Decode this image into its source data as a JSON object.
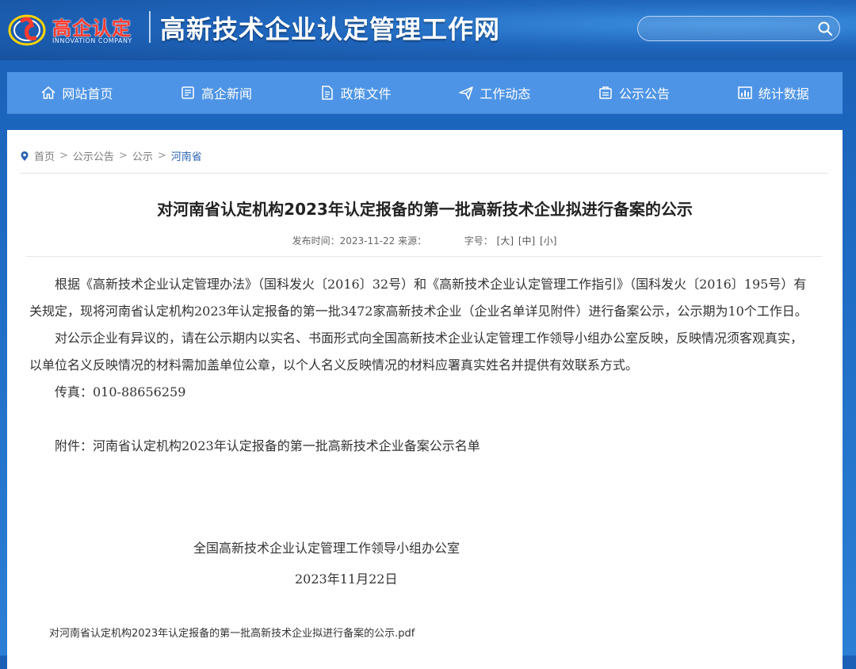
{
  "header": {
    "logo_cn": "高企认定",
    "logo_en": "INNOVATION COMPANY",
    "site_title": "高新技术企业认定管理工作网",
    "search_placeholder": ""
  },
  "nav": [
    {
      "label": "网站首页",
      "icon": "home-icon"
    },
    {
      "label": "高企新闻",
      "icon": "news-icon"
    },
    {
      "label": "政策文件",
      "icon": "document-icon"
    },
    {
      "label": "工作动态",
      "icon": "send-icon"
    },
    {
      "label": "公示公告",
      "icon": "notice-icon"
    },
    {
      "label": "统计数据",
      "icon": "chart-icon"
    }
  ],
  "breadcrumb": [
    "首页",
    "公示公告",
    "公示",
    "河南省"
  ],
  "article": {
    "title": "对河南省认定机构2023年认定报备的第一批高新技术企业拟进行备案的公示",
    "publish_label": "发布时间：2023-11-22 来源：",
    "font_size_label": "字号：",
    "font_sizes": [
      "[大]",
      "[中]",
      "[小]"
    ],
    "paragraphs": [
      "根据《高新技术企业认定管理办法》（国科发火〔2016〕32号）和《高新技术企业认定管理工作指引》（国科发火〔2016〕195号）有关规定，现将河南省认定机构2023年认定报备的第一批3472家高新技术企业（企业名单详见附件）进行备案公示，公示期为10个工作日。",
      "对公示企业有异议的，请在公示期内以实名、书面形式向全国高新技术企业认定管理工作领导小组办公室反映，反映情况须客观真实，以单位名义反映情况的材料需加盖单位公章，以个人名义反映情况的材料应署真实姓名并提供有效联系方式。",
      "传真：010-88656259",
      "附件：河南省认定机构2023年认定报备的第一批高新技术企业备案公示名单"
    ],
    "signature": "全国高新技术企业认定管理工作领导小组办公室",
    "date": "2023年11月22日",
    "attachment_file": "对河南省认定机构2023年认定报备的第一批高新技术企业拟进行备案的公示.pdf"
  },
  "colors": {
    "nav_bg": "#4e94e6",
    "header_bg": "#1f66bd",
    "breadcrumb_current": "#2a63b4",
    "logo_red": "#ff3b2f"
  }
}
